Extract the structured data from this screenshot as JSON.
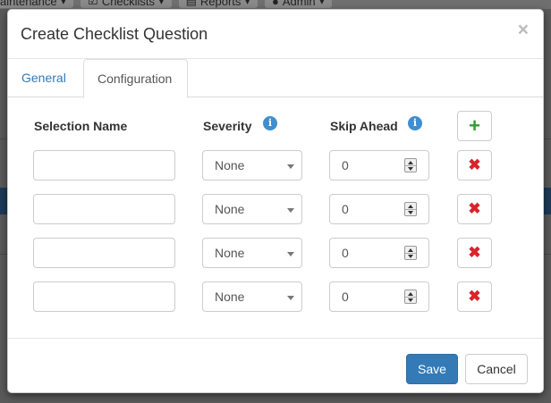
{
  "background": {
    "nav_items": [
      {
        "label": "aintenance",
        "icon": "caret-down-icon"
      },
      {
        "label": "Checklists",
        "icon": "checklist-icon"
      },
      {
        "label": "Reports",
        "icon": "reports-icon"
      },
      {
        "label": "Admin",
        "icon": "user-icon"
      }
    ]
  },
  "modal": {
    "title": "Create Checklist Question",
    "close_label": "×",
    "tabs": [
      {
        "label": "General",
        "active": false
      },
      {
        "label": "Configuration",
        "active": true
      }
    ],
    "columns": {
      "selection_name": "Selection Name",
      "severity": "Severity",
      "skip_ahead": "Skip Ahead"
    },
    "info_glyph": "i",
    "add_glyph": "+",
    "remove_glyph": "✖",
    "rows": [
      {
        "selection_name": "",
        "severity": "None",
        "skip_ahead": "0"
      },
      {
        "selection_name": "",
        "severity": "None",
        "skip_ahead": "0"
      },
      {
        "selection_name": "",
        "severity": "None",
        "skip_ahead": "0"
      },
      {
        "selection_name": "",
        "severity": "None",
        "skip_ahead": "0"
      }
    ],
    "footer": {
      "save_label": "Save",
      "cancel_label": "Cancel"
    }
  },
  "colors": {
    "primary": "#337ab7",
    "add_icon": "#2e9b35",
    "remove_icon": "#d9242c",
    "info_icon": "#3f8ed0"
  }
}
